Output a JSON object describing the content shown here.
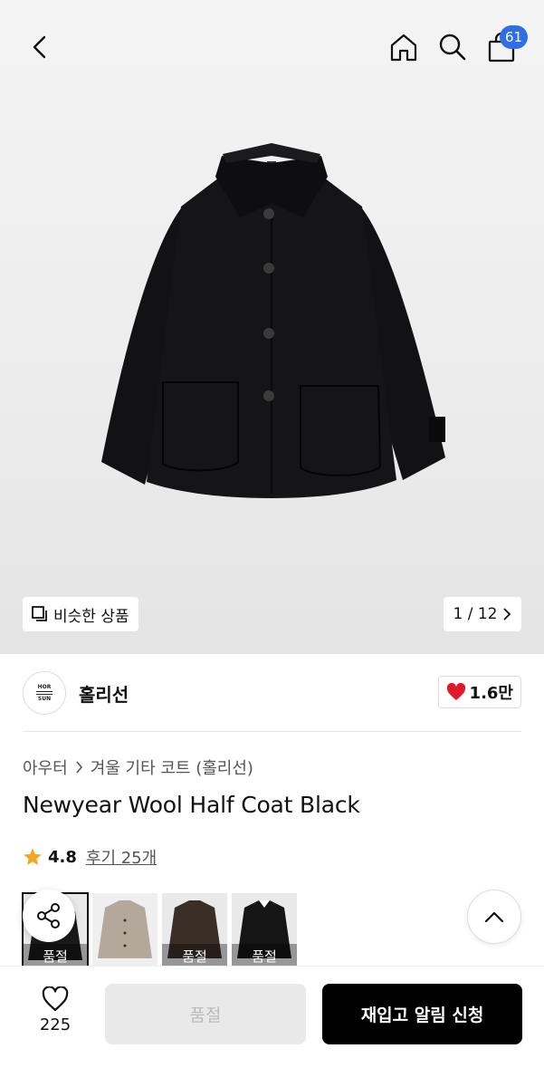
{
  "header": {
    "cart_count": "61"
  },
  "gallery": {
    "similar_label": "비슷한 상품",
    "pager": "1 / 12"
  },
  "brand": {
    "logo_line1": "HOR",
    "logo_line2": "SUN",
    "name": "홀리선",
    "likes": "1.6만"
  },
  "breadcrumb": {
    "category": "아우터",
    "subcategory": "겨울 기타 코트 (홀리선)"
  },
  "product": {
    "title": "Newyear Wool Half Coat Black",
    "rating": "4.8",
    "reviews": "후기 25개"
  },
  "thumbnails": [
    {
      "color": "#1a1a1a",
      "soldout": "품절",
      "selected": true
    },
    {
      "color": "#b3a89a",
      "soldout": "",
      "selected": false
    },
    {
      "color": "#3a2f27",
      "soldout": "품절",
      "selected": false
    },
    {
      "color": "#161616",
      "soldout": "품절",
      "selected": false
    }
  ],
  "bottom_bar": {
    "wish_count": "225",
    "soldout_label": "품절",
    "restock_label": "재입고 알림 신청"
  },
  "colors": {
    "badge": "#2f6fe4",
    "heart": "#e0192b",
    "star": "#f5a623"
  }
}
